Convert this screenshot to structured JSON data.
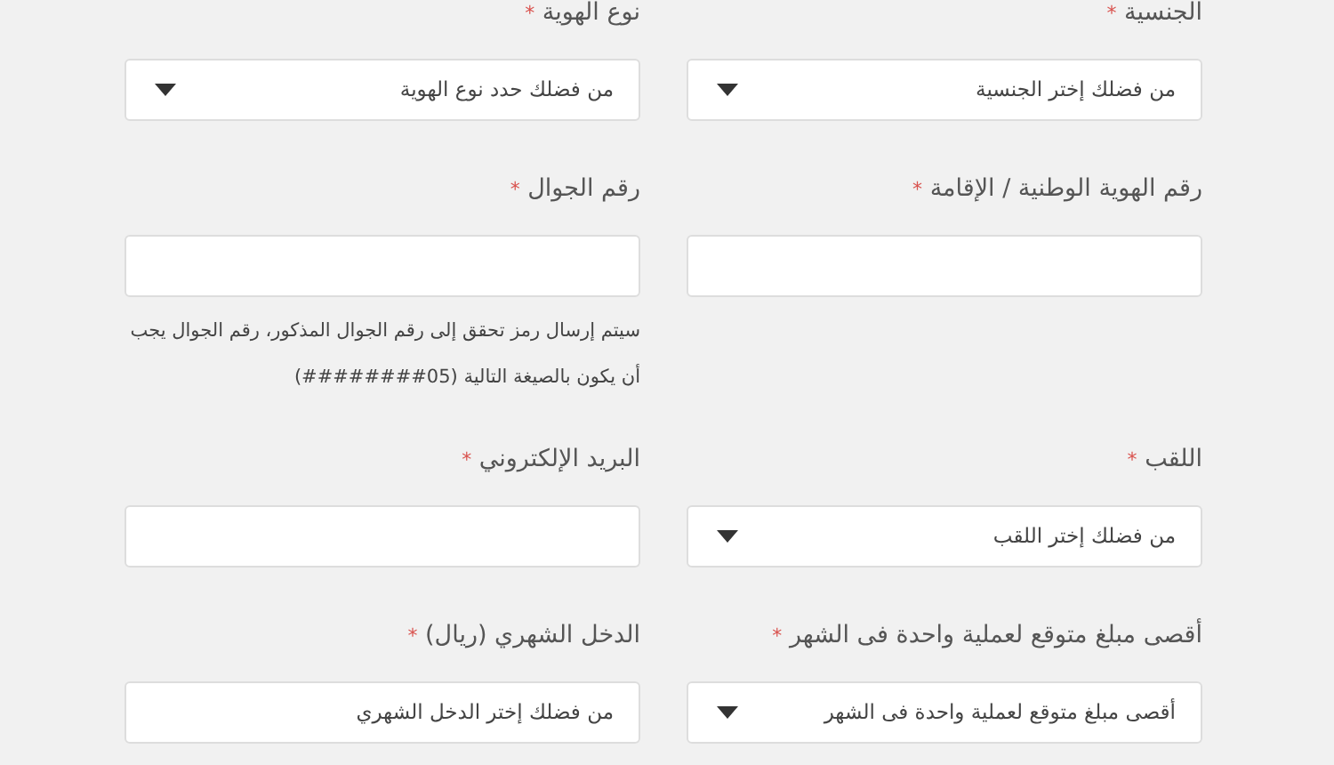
{
  "form": {
    "rows": [
      {
        "fields": [
          {
            "label": "الجنسية",
            "required": true,
            "required_mark": "*",
            "kind": "select",
            "value": "من فضلك إختر الجنسية"
          },
          {
            "label": "نوع الهوية",
            "required": true,
            "required_mark": "*",
            "kind": "select",
            "value": "من فضلك حدد نوع الهوية"
          }
        ]
      },
      {
        "fields": [
          {
            "label": "رقم الهوية الوطنية / الإقامة",
            "required": true,
            "required_mark": "*",
            "kind": "text"
          },
          {
            "label": "رقم الجوال",
            "required": true,
            "required_mark": "*",
            "kind": "text",
            "help": "سيتم إرسال رمز تحقق إلى رقم الجوال المذكور، رقم الجوال يجب أن يكون بالصيغة التالية  (05########)"
          }
        ]
      },
      {
        "fields": [
          {
            "label": "اللقب",
            "required": true,
            "required_mark": "*",
            "kind": "select",
            "value": "من فضلك إختر اللقب"
          },
          {
            "label": "البريد الإلكتروني",
            "required": true,
            "required_mark": "*",
            "kind": "text"
          }
        ]
      },
      {
        "fields": [
          {
            "label": "أقصى مبلغ متوقع لعملية واحدة فى الشهر",
            "required": true,
            "required_mark": "*",
            "kind": "select",
            "value": "أقصى مبلغ متوقع لعملية واحدة فى الشهر"
          },
          {
            "label": "الدخل الشهري (ريال)",
            "required": true,
            "required_mark": "*",
            "kind": "text",
            "value": "من فضلك إختر الدخل الشهري"
          }
        ]
      }
    ]
  }
}
